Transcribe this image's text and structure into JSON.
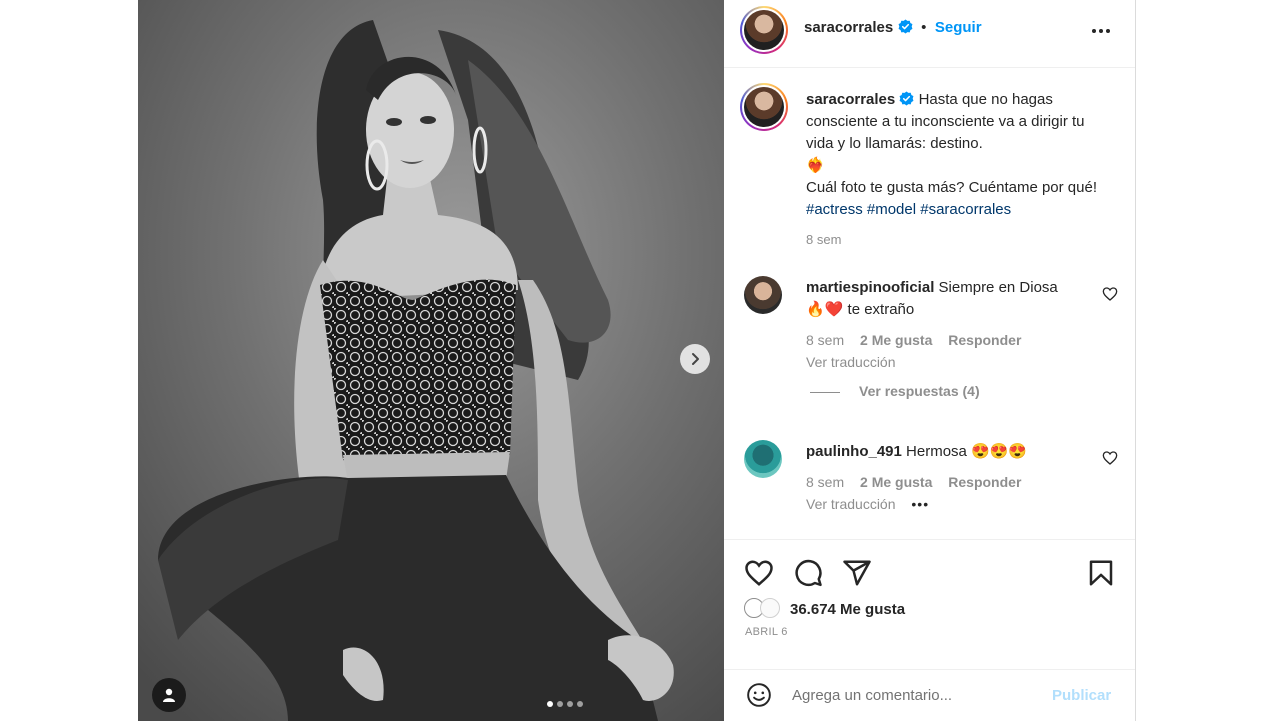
{
  "post": {
    "image_alt": "",
    "carousel": {
      "count": 4,
      "active_index": 0
    }
  },
  "header": {
    "username": "saracorrales",
    "separator": "•",
    "follow_label": "Seguir"
  },
  "caption": {
    "username": "saracorrales",
    "text_line1": "Hasta que no hagas consciente a tu inconsciente va a dirigir tu vida y lo llamarás: destino.",
    "emoji": "❤️‍🔥",
    "text_line2": "Cuál foto te gusta más? Cuéntame por qué!",
    "hashtags": [
      "#actress",
      "#model",
      "#saracorrales"
    ],
    "time": "8 sem"
  },
  "comments": [
    {
      "username": "martiespinooficial",
      "text": "Siempre en Diosa",
      "emojis": "🔥❤️",
      "text_after": "te extraño",
      "time": "8 sem",
      "likes": "2 Me gusta",
      "reply_label": "Responder",
      "translate_label": "Ver traducción",
      "view_replies_label": "Ver respuestas (4)"
    },
    {
      "username": "paulinho_491",
      "text": "Hermosa",
      "emojis": "😍😍😍",
      "time": "8 sem",
      "likes": "2 Me gusta",
      "reply_label": "Responder",
      "translate_label": "Ver traducción",
      "more_label": "•••"
    }
  ],
  "actions": {
    "likes_text": "36.674 Me gusta",
    "date": "ABRIL 6"
  },
  "add_comment": {
    "placeholder": "Agrega un comentario...",
    "publish_label": "Publicar"
  },
  "colors": {
    "accent": "#0095f6",
    "hashtag": "#00376b",
    "muted": "#8e8e8e",
    "like_red": "#ed4956",
    "publish_disabled": "#b2dffc"
  }
}
